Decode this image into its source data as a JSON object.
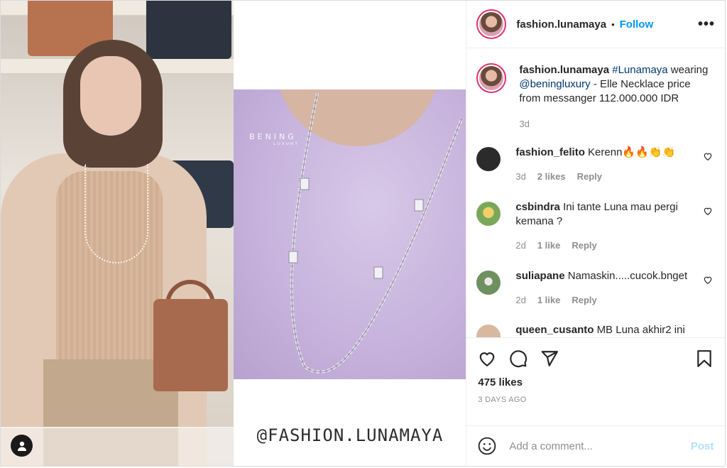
{
  "header": {
    "username": "fashion.lunamaya",
    "separator": "•",
    "follow_label": "Follow",
    "more_label": "•••"
  },
  "caption": {
    "username": "fashion.lunamaya",
    "hashtag": "#Lunamaya",
    "text_1": " wearing ",
    "mention": "@beningluxury",
    "text_2": " - Elle Necklace price from messanger 112.000.000 IDR",
    "time": "3d"
  },
  "comments": [
    {
      "username": "fashion_felito",
      "text": "Kerenn🔥🔥👏👏",
      "time": "3d",
      "likes": "2 likes",
      "reply": "Reply",
      "avatar_color": "#2b2b2b"
    },
    {
      "username": "csbindra",
      "text": "Ini tante Luna mau pergi kemana ?",
      "time": "2d",
      "likes": "1 like",
      "reply": "Reply",
      "avatar_color": "#7aa85a"
    },
    {
      "username": "suliapane",
      "text": "Namaskin.....cucok.bnget",
      "time": "2d",
      "likes": "1 like",
      "reply": "Reply",
      "avatar_color": "#6f8f5f"
    },
    {
      "username": "queen_cusanto",
      "text": "MB Luna akhir2 ini",
      "avatar_color": "#d9b8a0"
    }
  ],
  "actions": {
    "likes": "475 likes",
    "ago": "3 DAYS AGO"
  },
  "composer": {
    "placeholder": "Add a comment...",
    "post_label": "Post"
  },
  "media": {
    "brand": "BENING",
    "brand_sub": "LUXURY",
    "watermark": "@FASHION.LUNAMAYA"
  },
  "colors": {
    "link": "#00376b",
    "follow": "#0095f6",
    "muted": "#8e8e8e",
    "post_disabled": "#b2dffc"
  }
}
